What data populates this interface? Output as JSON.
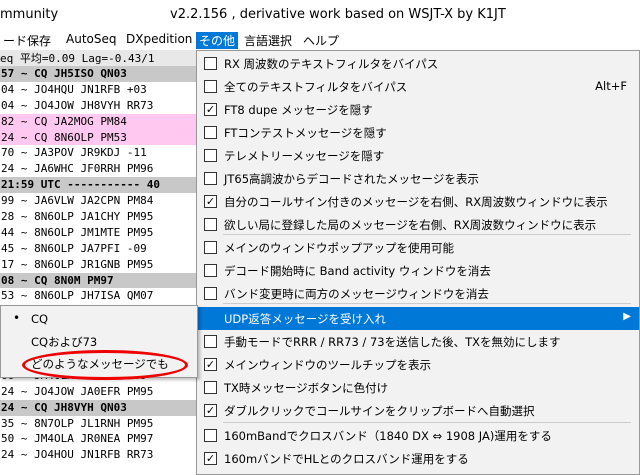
{
  "title": {
    "app": "mmunity",
    "version": "v2.2.156 , derivative work based on WSJT-X by K1JT"
  },
  "menubar": [
    "ード",
    "保存",
    "AutoSeq",
    "DXpedition",
    "その他",
    "言語選択",
    "ヘルプ"
  ],
  "band_header": "eq   平均=0.09 Lag=-0.43/1",
  "decodes": [
    {
      "text": "57 ~ CQ JH5ISO QN03",
      "style": "gray"
    },
    {
      "text": "04 ~ JO4HQU JN1RFB +03",
      "style": ""
    },
    {
      "text": "04 ~ JO4JOW JH8VYH RR73",
      "style": ""
    },
    {
      "text": "82 ~ CQ JA2MOG PM84",
      "style": "pink"
    },
    {
      "text": "24 ~ CQ 8N6OLP PM53",
      "style": "pink"
    },
    {
      "text": "70 ~ JA3POV JR9KDJ -11",
      "style": ""
    },
    {
      "text": "24 ~ JA6WHC JF0RRH PM96",
      "style": ""
    },
    {
      "text": "21:59 UTC ----------- 40",
      "style": "gray"
    },
    {
      "text": "99 ~ JA6VLW JA2CPN PM84",
      "style": ""
    },
    {
      "text": "28 ~ 8N6OLP JA1CHY PM95",
      "style": ""
    },
    {
      "text": "44 ~ 8N6OLP JM1MTE PM95",
      "style": ""
    },
    {
      "text": "45 ~ 8N6OLP JA7PFI -09",
      "style": ""
    },
    {
      "text": "17 ~ 8N6OLP JR1GNB PM95",
      "style": ""
    },
    {
      "text": "08 ~ CQ 8N0M PM97",
      "style": "gray"
    },
    {
      "text": "53 ~ 8N6OLP JH7ISA QM07",
      "style": ""
    },
    {
      "text": "",
      "style": ""
    },
    {
      "text": "",
      "style": ""
    },
    {
      "text": "",
      "style": ""
    },
    {
      "text": "",
      "style": ""
    },
    {
      "text": "66 ~ JM4OLA JM1QUJ -09",
      "style": ""
    },
    {
      "text": "24 ~ JO4JOW JA0EFR PM95",
      "style": ""
    },
    {
      "text": "24 ~ CQ JH8VYH QN03",
      "style": "gray"
    },
    {
      "text": "35 ~ 8N7OLP JL1RNH PM95",
      "style": ""
    },
    {
      "text": "50 ~ JM4OLA JR0NEA PM97",
      "style": ""
    },
    {
      "text": "24 ~ JO4HOU JN1RFB RR73",
      "style": ""
    }
  ],
  "menu": [
    {
      "label": "RX 周波数のテキストフィルタをバイパス",
      "checked": false,
      "shortcut": ""
    },
    {
      "label": "全てのテキストフィルタをバイパス",
      "checked": false,
      "shortcut": "Alt+F"
    },
    {
      "label": "FT8 dupe メッセージを隠す",
      "checked": true,
      "shortcut": ""
    },
    {
      "label": "FTコンテストメッセージを隠す",
      "checked": false,
      "shortcut": ""
    },
    {
      "label": "テレメトリーメッセージを隠す",
      "checked": false,
      "shortcut": ""
    },
    {
      "label": "JT65高調波からデコードされたメッセージを表示",
      "checked": false,
      "shortcut": ""
    },
    {
      "label": "自分のコールサイン付きのメッセージを右側、RX周波数ウィンドウに表示",
      "checked": true,
      "shortcut": ""
    },
    {
      "label": "欲しい局に登録した局のメッセージを右側、RX周波数ウィンドウに表示",
      "checked": false,
      "shortcut": ""
    },
    {
      "label": "メインのウィンドウポップアップを使用可能",
      "checked": false,
      "shortcut": ""
    },
    {
      "label": "デコード開始時に Band activity ウィンドウを消去",
      "checked": false,
      "shortcut": ""
    },
    {
      "label": "バンド変更時に両方のメッセージウィンドウを消去",
      "checked": false,
      "shortcut": ""
    },
    {
      "label": "UDP返答メッセージを受け入れ",
      "checked": null,
      "shortcut": "",
      "highlight": true
    },
    {
      "label": "手動モードでRRR / RR73 / 73を送信した後、TXを無効にします",
      "checked": false,
      "shortcut": ""
    },
    {
      "label": "メインウィンドウのツールチップを表示",
      "checked": true,
      "shortcut": ""
    },
    {
      "label": "TX時メッセージボタンに色付け",
      "checked": false,
      "shortcut": ""
    },
    {
      "label": "ダブルクリックでコールサインをクリップボードへ自動選択",
      "checked": true,
      "shortcut": ""
    },
    {
      "label": "160mBandでクロスバンド（1840 DX ⇔ 1908 JA)運用をする",
      "checked": false,
      "shortcut": ""
    },
    {
      "label": "160mバンドでHLとのクロスバンド運用をする",
      "checked": true,
      "shortcut": ""
    }
  ],
  "submenu": [
    {
      "label": "CQ",
      "selected": true
    },
    {
      "label": "CQおよび73",
      "selected": false
    },
    {
      "label": "どのようなメッセージでも",
      "selected": false
    }
  ]
}
